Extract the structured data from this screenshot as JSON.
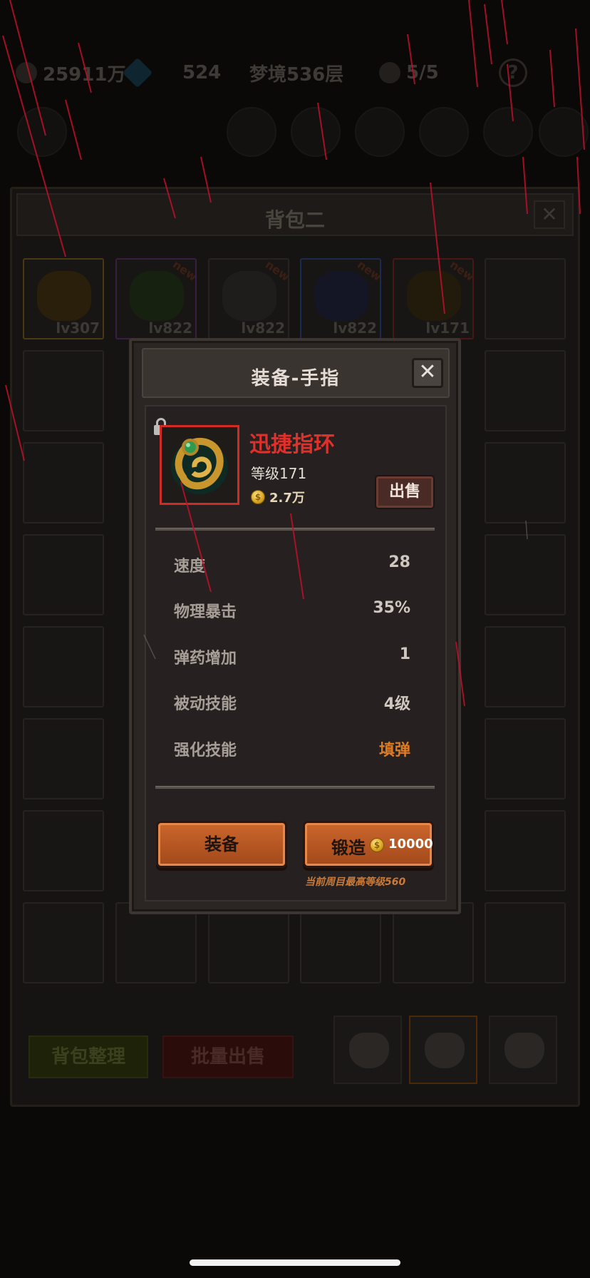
{
  "topbar": {
    "gold": "25911万",
    "gems": "524",
    "dream_floor": "梦境536层",
    "keys": "5/5",
    "help": "?"
  },
  "bag": {
    "title": "背包二",
    "close": "✕",
    "items": [
      {
        "level": "lv307",
        "tag": "",
        "rarity": "gold"
      },
      {
        "level": "lv822",
        "tag": "new",
        "rarity": "purple"
      },
      {
        "level": "lv822",
        "tag": "new",
        "rarity": "gray"
      },
      {
        "level": "lv822",
        "tag": "new",
        "rarity": "blue"
      },
      {
        "level": "lv171",
        "tag": "new",
        "rarity": "red"
      }
    ],
    "sort_button": "背包整理",
    "bulk_sell_button": "批量出售"
  },
  "dialog": {
    "title": "装备-手指",
    "close": "✕",
    "item": {
      "name": "迅捷指环",
      "level": "等级171",
      "price": "2.7万",
      "sell_button": "出售",
      "name_color": "#e0302a"
    },
    "stats": [
      {
        "label": "速度",
        "value": "28"
      },
      {
        "label": "物理暴击",
        "value": "35%"
      },
      {
        "label": "弹药增加",
        "value": "1"
      },
      {
        "label": "被动技能",
        "value": "4级"
      },
      {
        "label": "强化技能",
        "value": "填弹",
        "highlight": "#e07a1f"
      }
    ],
    "equip_button": "装备",
    "forge_button": "锻造",
    "forge_cost": "10000",
    "forge_note": "当前周目最高等级560"
  }
}
